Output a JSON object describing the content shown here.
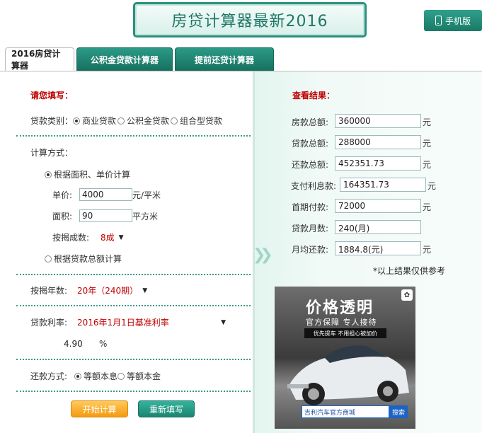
{
  "header": {
    "title": "房贷计算器最新2016",
    "mobile_label": "手机版"
  },
  "tabs": [
    {
      "label": "2016房贷计算器"
    },
    {
      "label": "公积金贷款计算器"
    },
    {
      "label": "提前还贷计算器"
    }
  ],
  "form": {
    "section_title": "请您填写：",
    "loan_type_label": "贷款类别：",
    "loan_types": [
      "商业贷款",
      "公积金贷款",
      "组合型贷款"
    ],
    "calc_method_label": "计算方式：",
    "method_area": "根据面积、单价计算",
    "unit_price_label": "单价:",
    "unit_price_value": "4000",
    "unit_price_unit": "元/平米",
    "area_label": "面积:",
    "area_value": "90",
    "area_unit": "平方米",
    "mortgage_ratio_label": "按揭成数:",
    "mortgage_ratio_value": "8成",
    "method_total": "根据贷款总额计算",
    "years_label": "按揭年数:",
    "years_value": "20年（240期）",
    "rate_label": "贷款利率:",
    "rate_value": "2016年1月1日基准利率",
    "rate_input": "4.90",
    "rate_unit": "%",
    "repay_label": "还款方式:",
    "repay_options": [
      "等额本息",
      "等额本金"
    ],
    "calc_button": "开始计算",
    "reset_button": "重新填写"
  },
  "results": {
    "section_title": "查看结果：",
    "rows": [
      {
        "label": "房款总额:",
        "value": "360000",
        "unit": "元"
      },
      {
        "label": "贷款总额:",
        "value": "288000",
        "unit": "元"
      },
      {
        "label": "还款总额:",
        "value": "452351.73",
        "unit": "元"
      },
      {
        "label": "支付利息款:",
        "value": "164351.73",
        "unit": "元"
      },
      {
        "label": "首期付款:",
        "value": "72000",
        "unit": "元"
      },
      {
        "label": "贷款月数:",
        "value": "240(月)",
        "unit": ""
      },
      {
        "label": "月均还款:",
        "value": "1884.8(元)",
        "unit": "元"
      }
    ],
    "note": "*以上结果仅供参考"
  },
  "ad": {
    "title": "价格透明",
    "subtitle": "官方保障 专人接待",
    "bar": "优先提车 不用担心被加价",
    "search_text": "吉利汽车官方商城",
    "search_button": "搜索"
  }
}
